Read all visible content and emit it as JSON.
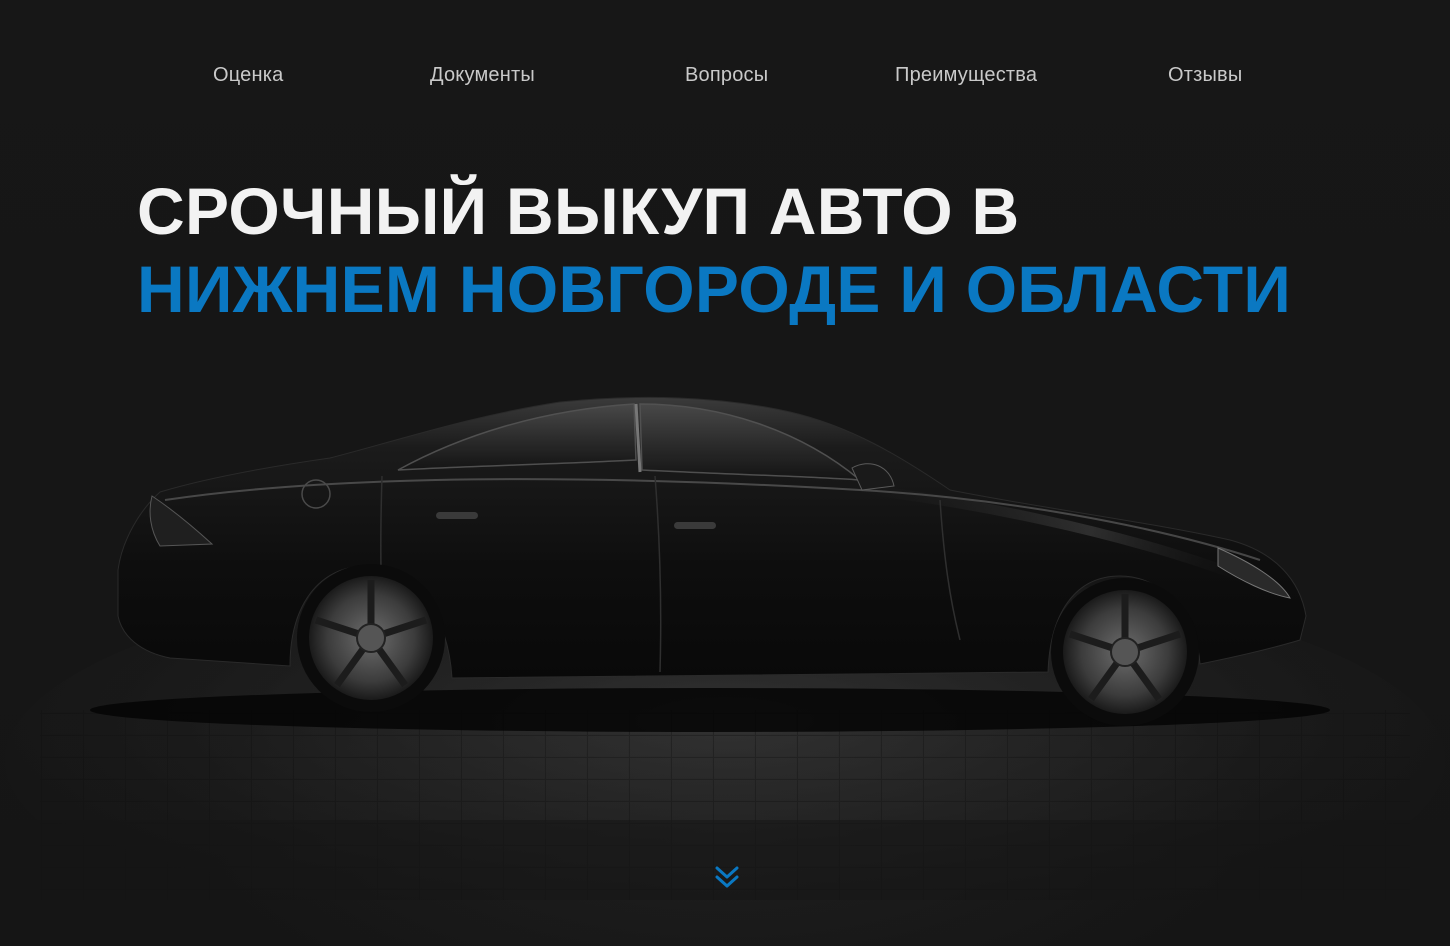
{
  "nav": {
    "items": [
      {
        "label": "Оценка"
      },
      {
        "label": "Документы"
      },
      {
        "label": "Вопросы"
      },
      {
        "label": "Преимущества"
      },
      {
        "label": "Отзывы"
      }
    ]
  },
  "hero": {
    "headline_line1": "СРОЧНЫЙ ВЫКУП АВТО В",
    "headline_line2": "НИЖНЕМ НОВГОРОДЕ И ОБЛАСТИ",
    "image": "dark-sedan-side-view",
    "scroll_icon": "double-chevron-down-icon"
  },
  "colors": {
    "background": "#161616",
    "headline_primary": "#f2f2f2",
    "headline_accent": "#0a78c2",
    "nav_text": "#c9c9c9",
    "arrow": "#0a78c2"
  }
}
